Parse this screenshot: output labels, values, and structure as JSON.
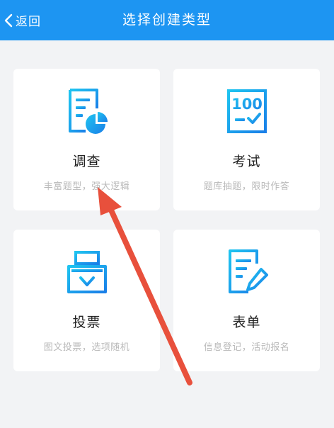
{
  "header": {
    "back_label": "返回",
    "title": "选择创建类型"
  },
  "cards": [
    {
      "name": "调查",
      "desc": "丰富题型，强大逻辑"
    },
    {
      "name": "考试",
      "desc": "题库抽题，限时作答"
    },
    {
      "name": "投票",
      "desc": "图文投票，选项随机"
    },
    {
      "name": "表单",
      "desc": "信息登记，活动报名"
    }
  ],
  "icons": {
    "survey": "survey-chart-icon",
    "exam": "score-100-icon",
    "exam_icon_text": "100",
    "vote": "ballot-box-icon",
    "form": "form-edit-icon"
  },
  "colors": {
    "header": "#1d95f2",
    "icon_start": "#1fc4f0",
    "icon_end": "#1a7fe8",
    "annotation_arrow": "#e8503c"
  }
}
